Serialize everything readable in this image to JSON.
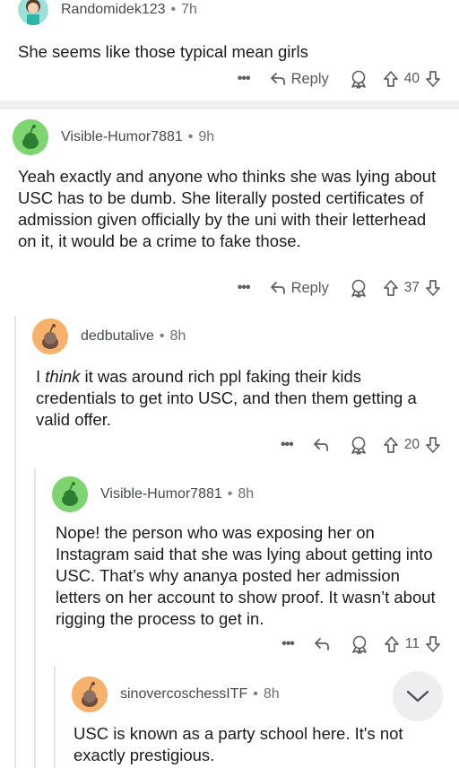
{
  "comments": [
    {
      "username": "Randomidek123",
      "time": "7h",
      "body": "She seems like those typical mean girls",
      "reply_label": "Reply",
      "score": "40",
      "avatar_color": "#4fd1c5"
    },
    {
      "username": "Visible-Humor7881",
      "time": "9h",
      "body": "Yeah exactly and anyone who thinks she was lying about USC has to be dumb. She literally posted certificates of admission given officially by the uni with their letterhead on it, it would be a crime to fake those.",
      "reply_label": "Reply",
      "score": "37",
      "avatar_color": "#7ed56f"
    },
    {
      "username": "dedbutalive",
      "time": "8h",
      "body_before": "I ",
      "body_emph": "think",
      "body_after": " it was around rich ppl faking their kids credentials to get into USC, and then them getting a valid offer.",
      "score": "20",
      "avatar_color": "#f6b26b"
    },
    {
      "username": "Visible-Humor7881",
      "time": "8h",
      "body": "Nope! the person who was exposing her on Instagram said that she was lying about getting into USC. That’s why ananya posted her admission letters on her account to show proof. It wasn’t about rigging the process to get in.",
      "score": "11",
      "avatar_color": "#7ed56f"
    },
    {
      "username": "sinovercoschessITF",
      "time": "8h",
      "body": "USC is known as a party school here. It's not exactly prestigious.",
      "avatar_color": "#f6b26b"
    }
  ],
  "more_label": "•••",
  "dot": "•"
}
